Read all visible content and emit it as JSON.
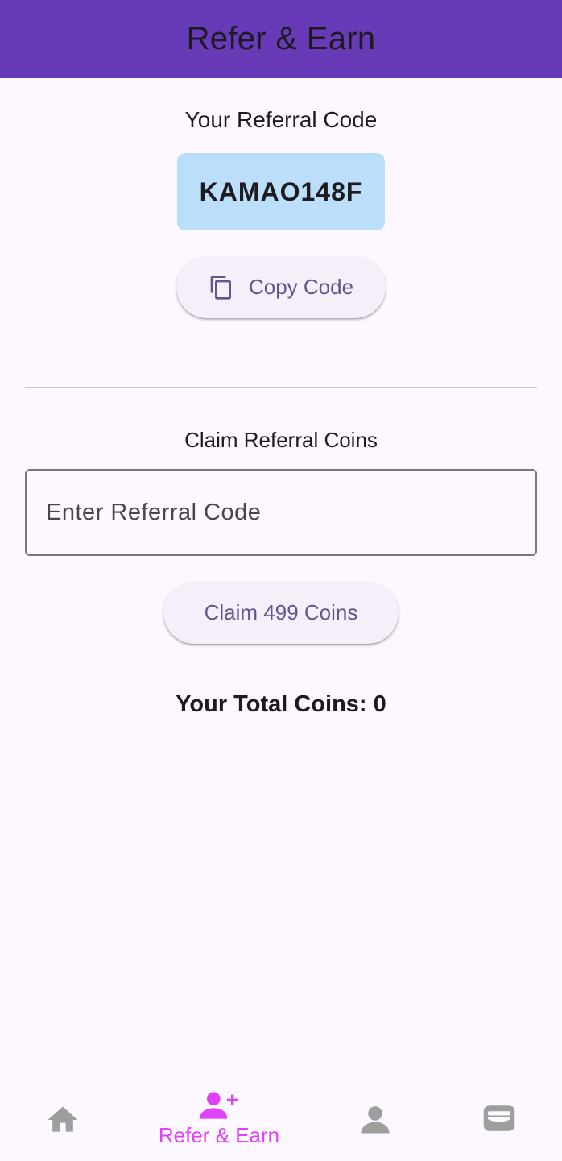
{
  "app_bar": {
    "title": "Refer & Earn",
    "color": "#673ab7"
  },
  "referral": {
    "heading": "Your Referral Code",
    "code": "KAMAO148F",
    "copy_button_label": "Copy Code",
    "copy_icon": "copy-icon"
  },
  "claim": {
    "heading": "Claim Referral Coins",
    "input_placeholder": "Enter Referral Code",
    "input_value": "",
    "claim_button_label": "Claim 499 Coins"
  },
  "total": {
    "text": "Your Total Coins: 0"
  },
  "bottom_nav": {
    "active_color": "#e040fb",
    "inactive_color": "#9e9e9e",
    "items": [
      {
        "icon": "home-icon",
        "label": "",
        "active": false
      },
      {
        "icon": "person-add-icon",
        "label": "Refer & Earn",
        "active": true
      },
      {
        "icon": "person-icon",
        "label": "",
        "active": false
      },
      {
        "icon": "wallet-icon",
        "label": "",
        "active": false
      }
    ]
  }
}
